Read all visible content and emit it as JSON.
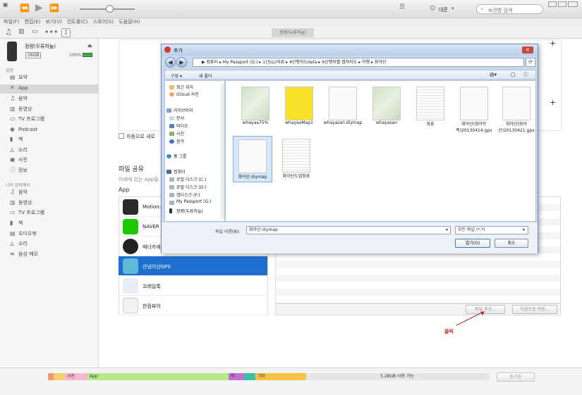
{
  "window": {
    "user_label": "대준",
    "search_placeholder": "보관함 검색"
  },
  "menu": [
    "파일(F)",
    "편집(E)",
    "보기(V)",
    "컨트롤(C)",
    "스토어(S)",
    "도움말(H)"
  ],
  "device_tab": "정량(두류하늘)",
  "device": {
    "name": "정량(두류하늘)",
    "capacity": "16GB",
    "battery": "100%"
  },
  "sidebar": {
    "section_settings": "설정",
    "settings_items": [
      {
        "label": "요약"
      },
      {
        "label": "App"
      },
      {
        "label": "음악"
      },
      {
        "label": "동영상"
      },
      {
        "label": "TV 프로그램"
      },
      {
        "label": "Podcast"
      },
      {
        "label": "책"
      },
      {
        "label": "소리"
      },
      {
        "label": "사진"
      },
      {
        "label": "정보"
      }
    ],
    "section_device": "나의 장비에서",
    "device_items": [
      {
        "label": "음악"
      },
      {
        "label": "동영상"
      },
      {
        "label": "TV 프로그램"
      },
      {
        "label": "책"
      },
      {
        "label": "오디오북"
      },
      {
        "label": "소리"
      },
      {
        "label": "음성 메모"
      }
    ]
  },
  "main": {
    "auto_sync_label": "자동으로 새로",
    "file_share_title": "파일 공유",
    "file_share_desc": "아래에 있는 App을",
    "apps_header": "App",
    "apps": [
      {
        "name": "Motion:"
      },
      {
        "name": "NAVER"
      },
      {
        "name": "매너카에"
      },
      {
        "name": "산넘어산GPS"
      },
      {
        "name": "코레일톡"
      },
      {
        "name": "한컴뷰어"
      }
    ],
    "add_file_button": "파일 추가...",
    "save_to_button": "다음으로 저장..."
  },
  "dialog": {
    "title": "추가",
    "address": "▶ 컴퓨터 ▸ My Passport (G:) ▸ 1산(山)자료 ▸ 4산행지도data ▸ 6산행지별 캡쳐지도 ▸ 하행 ▸ 화야산",
    "organize": "구성 ▾",
    "new_folder": "새 폴더",
    "nav": [
      {
        "label": "최근 위치"
      },
      {
        "label": "iCloud 사진"
      },
      {
        "label": "라이브러리"
      },
      {
        "label": "문서"
      },
      {
        "label": "비디오"
      },
      {
        "label": "사진"
      },
      {
        "label": "음악"
      },
      {
        "label": "홈 그룹"
      },
      {
        "label": "컴퓨터"
      },
      {
        "label": "로컬 디스크 (C:)"
      },
      {
        "label": "로컬 디스크 (D:)"
      },
      {
        "label": "엠디스크 (F:)"
      },
      {
        "label": "My Passport (G:)"
      },
      {
        "label": "정량(두류하늘)"
      }
    ],
    "files_row1": [
      {
        "name": "whayaa75%"
      },
      {
        "name": "whayaaMap1"
      },
      {
        "name": "whayasan.diymap"
      },
      {
        "name": "whayasan"
      },
      {
        "name": "좌표"
      },
      {
        "name": "화야산(화야트폭)20130414.gpx"
      },
      {
        "name": "화야산(화야산)20130421.gpx"
      }
    ],
    "files_row2": [
      {
        "name": "화야산.diymap"
      },
      {
        "name": "화야산도엽좌표"
      }
    ],
    "filename_label": "파일 이름(N):",
    "filename_value": "화야산.diymap",
    "filetype_value": "모든 파일 (*.*)",
    "open_button": "열기(O)",
    "cancel_button": "취소"
  },
  "annotations": {
    "open_note": "열기",
    "click_note": "클릭"
  },
  "storage": {
    "segments": [
      {
        "label": "",
        "color": "#f19a6c"
      },
      {
        "label": "",
        "color": "#f4d06a"
      },
      {
        "label": "사진",
        "color": "#f7b9cf"
      },
      {
        "label": "App",
        "color": "#b8e986"
      },
      {
        "label": "책",
        "color": "#c36fd0"
      },
      {
        "label": "",
        "color": "#3cc1a0"
      },
      {
        "label": "기타",
        "color": "#f6c244"
      },
      {
        "label": "5.28GB 사용 가능",
        "color": "#e6e6e6"
      }
    ],
    "sync_button": "동기화"
  }
}
